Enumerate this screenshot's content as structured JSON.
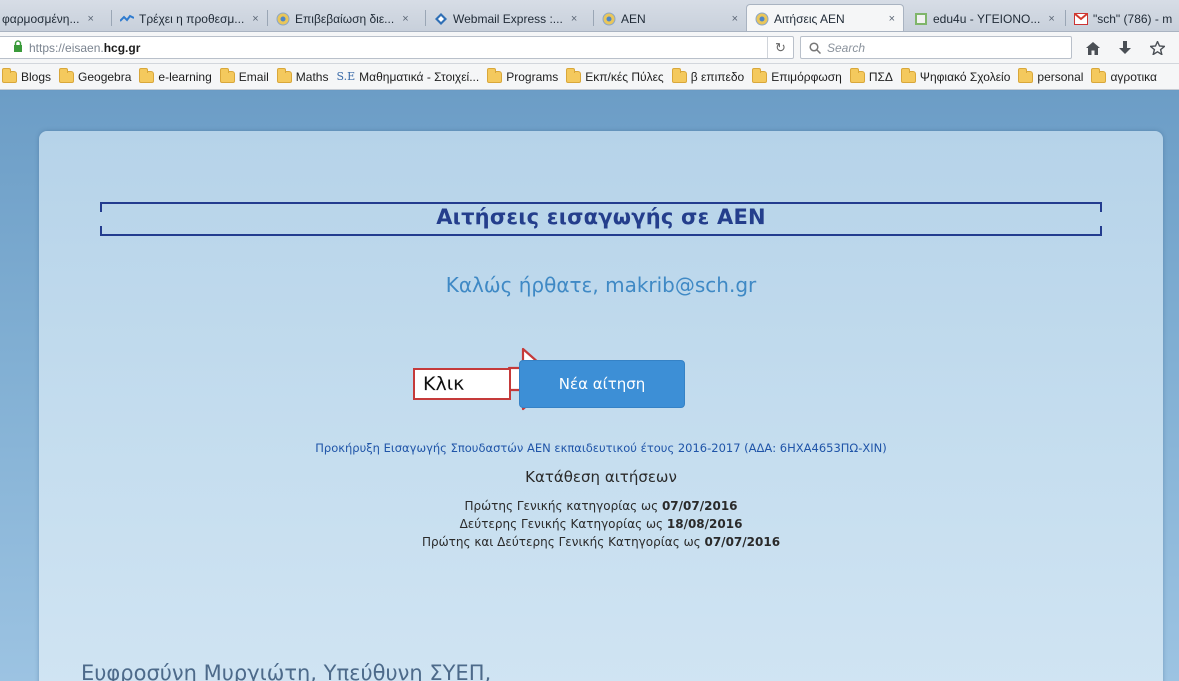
{
  "browser": {
    "tabs": [
      {
        "label": "φαρμοσμένη...",
        "icon": "page-icon",
        "active": false
      },
      {
        "label": "Τρέχει η προθεσμ...",
        "icon": "chart-icon",
        "active": false
      },
      {
        "label": "Επιβεβαίωση διε...",
        "icon": "site-icon",
        "active": false
      },
      {
        "label": "Webmail Express :...",
        "icon": "webmail-icon",
        "active": false
      },
      {
        "label": "ΑΕΝ",
        "icon": "site-icon",
        "active": false
      },
      {
        "label": "Αιτήσεις ΑΕΝ",
        "icon": "site-icon",
        "active": true
      },
      {
        "label": "edu4u - ΥΓΕΙΟΝΟ...",
        "icon": "edu-icon",
        "active": false
      },
      {
        "label": "\"sch\" (786) - m",
        "icon": "gmail-icon",
        "active": false
      }
    ],
    "close_glyph": "×",
    "url_prefix": "https://eisaen.",
    "url_host": "hcg.gr",
    "search_placeholder": "Search",
    "bookmarks": [
      {
        "label": "Blogs",
        "type": "folder"
      },
      {
        "label": "Geogebra",
        "type": "folder"
      },
      {
        "label": "e-learning",
        "type": "folder"
      },
      {
        "label": "Email",
        "type": "folder"
      },
      {
        "label": "Maths",
        "type": "folder"
      },
      {
        "label": "Μαθηματικά - Στοιχεί...",
        "type": "link",
        "mark": "S.E"
      },
      {
        "label": "Programs",
        "type": "folder"
      },
      {
        "label": "Εκπ/κές Πύλες",
        "type": "folder"
      },
      {
        "label": "β επιπεδο",
        "type": "folder"
      },
      {
        "label": "Επιμόρφωση",
        "type": "folder"
      },
      {
        "label": "ΠΣΔ",
        "type": "folder"
      },
      {
        "label": "Ψηφιακό Σχολείο",
        "type": "folder"
      },
      {
        "label": "personal",
        "type": "folder"
      },
      {
        "label": "αγροτικα",
        "type": "folder"
      }
    ]
  },
  "page": {
    "title": "Αιτήσεις εισαγωγής σε ΑΕΝ",
    "welcome": "Καλώς ήρθατε, makrib@sch.gr",
    "new_button": "Νέα αίτηση",
    "callout_label": "Κλικ",
    "announcement": "Προκήρυξη Εισαγωγής Σπουδαστών ΑΕΝ εκπαιδευτικού έτους 2016-2017 (ΑΔΑ: 6ΗΧΑ4653ΠΩ-ΧΙΝ)",
    "deposit_heading": "Κατάθεση αιτήσεων",
    "deadlines": [
      {
        "text": "Πρώτης Γενικής κατηγορίας ως ",
        "date": "07/07/2016"
      },
      {
        "text": "Δεύτερης Γενικής Κατηγορίας ως ",
        "date": "18/08/2016"
      },
      {
        "text": "Πρώτης και Δεύτερης Γενικής Κατηγορίας ως ",
        "date": "07/07/2016"
      }
    ],
    "footer_author": "Ευφροσύνη Μυργιώτη, Υπεύθυνη ΣΥΕΠ,"
  }
}
